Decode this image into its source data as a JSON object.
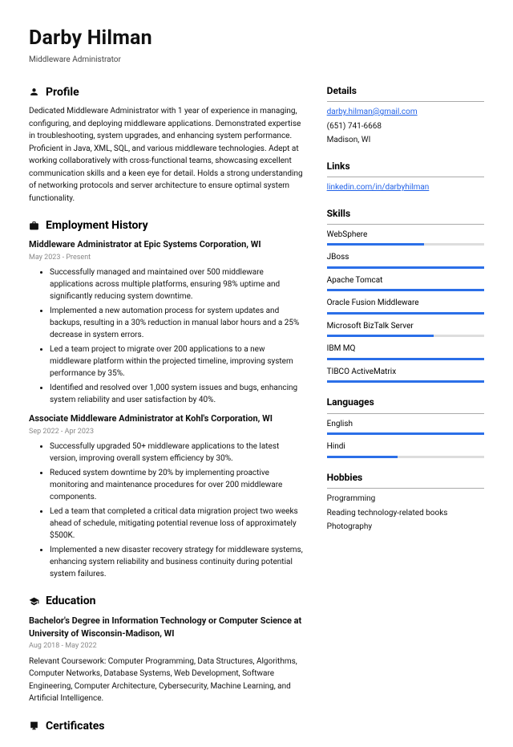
{
  "name": "Darby Hilman",
  "role": "Middleware Administrator",
  "sections": {
    "profile_head": "Profile",
    "employment_head": "Employment History",
    "education_head": "Education",
    "certificates_head": "Certificates"
  },
  "profile": "Dedicated Middleware Administrator with 1 year of experience in managing, configuring, and deploying middleware applications. Demonstrated expertise in troubleshooting, system upgrades, and enhancing system performance. Proficient in Java, XML, SQL, and various middleware technologies. Adept at working collaboratively with cross-functional teams, showcasing excellent communication skills and a keen eye for detail. Holds a strong understanding of networking protocols and server architecture to ensure optimal system functionality.",
  "jobs": [
    {
      "title": "Middleware Administrator at Epic Systems Corporation, WI",
      "dates": "May 2023 - Present",
      "bullets": [
        "Successfully managed and maintained over 500 middleware applications across multiple platforms, ensuring 98% uptime and significantly reducing system downtime.",
        "Implemented a new automation process for system updates and backups, resulting in a 30% reduction in manual labor hours and a 25% decrease in system errors.",
        "Led a team project to migrate over 200 applications to a new middleware platform within the projected timeline, improving system performance by 35%.",
        "Identified and resolved over 1,000 system issues and bugs, enhancing system reliability and user satisfaction by 40%."
      ]
    },
    {
      "title": "Associate Middleware Administrator at Kohl's Corporation, WI",
      "dates": "Sep 2022 - Apr 2023",
      "bullets": [
        "Successfully upgraded 50+ middleware applications to the latest version, improving overall system efficiency by 30%.",
        "Reduced system downtime by 20% by implementing proactive monitoring and maintenance procedures for over 200 middleware components.",
        "Led a team that completed a critical data migration project two weeks ahead of schedule, mitigating potential revenue loss of approximately $500K.",
        "Implemented a new disaster recovery strategy for middleware systems, enhancing system reliability and business continuity during potential system failures."
      ]
    }
  ],
  "education": {
    "title": "Bachelor's Degree in Information Technology or Computer Science at University of Wisconsin-Madison, WI",
    "dates": "Aug 2018 - May 2022",
    "desc": "Relevant Coursework: Computer Programming, Data Structures, Algorithms, Computer Networks, Database Systems, Web Development, Software Engineering, Computer Architecture, Cybersecurity, Machine Learning, and Artificial Intelligence."
  },
  "side": {
    "details_head": "Details",
    "email": "darby.hilman@gmail.com",
    "phone": "(651) 741-6668",
    "location": "Madison, WI",
    "links_head": "Links",
    "linkedin": "linkedin.com/in/darbyhilman",
    "skills_head": "Skills",
    "skills": [
      {
        "name": "WebSphere",
        "pct": 62
      },
      {
        "name": "JBoss",
        "pct": 100
      },
      {
        "name": "Apache Tomcat",
        "pct": 100
      },
      {
        "name": "Oracle Fusion Middleware",
        "pct": 100
      },
      {
        "name": "Microsoft BizTalk Server",
        "pct": 68
      },
      {
        "name": "IBM MQ",
        "pct": 100
      },
      {
        "name": "TIBCO ActiveMatrix",
        "pct": 100
      }
    ],
    "languages_head": "Languages",
    "languages": [
      {
        "name": "English",
        "pct": 100
      },
      {
        "name": "Hindi",
        "pct": 45
      }
    ],
    "hobbies_head": "Hobbies",
    "hobbies": [
      "Programming",
      "Reading technology-related books",
      "Photography"
    ]
  }
}
